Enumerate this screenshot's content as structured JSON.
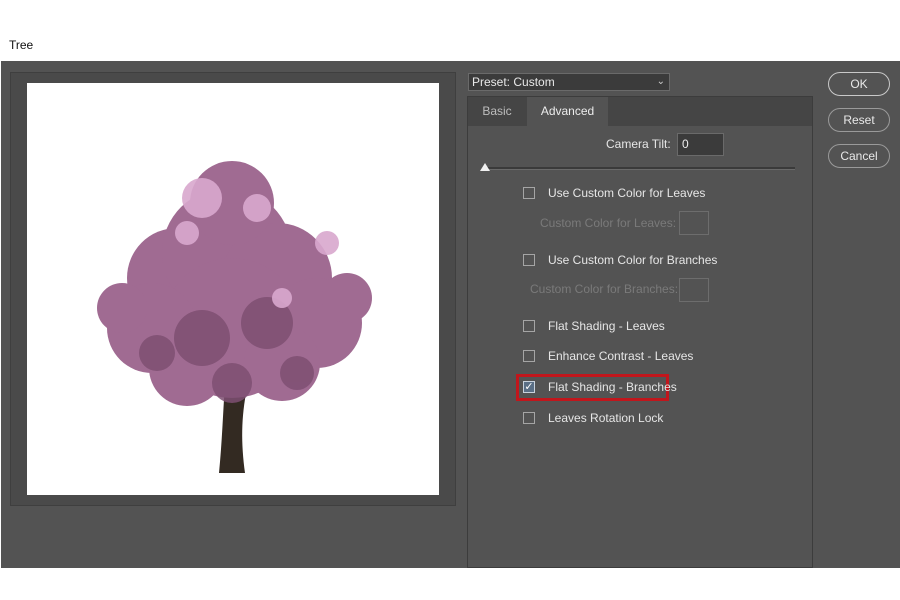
{
  "window": {
    "title": "Tree"
  },
  "preset": {
    "label": "Preset: Custom"
  },
  "tabs": [
    {
      "label": "Basic",
      "active": false
    },
    {
      "label": "Advanced",
      "active": true
    }
  ],
  "camera_tilt": {
    "label": "Camera Tilt:",
    "value": "0"
  },
  "options": {
    "custom_color_leaves": {
      "label": "Use Custom Color for Leaves",
      "checked": false
    },
    "custom_color_leaves_field": {
      "label": "Custom Color for Leaves:"
    },
    "custom_color_branches": {
      "label": "Use Custom Color for Branches",
      "checked": false
    },
    "custom_color_branches_field": {
      "label": "Custom Color for Branches:"
    },
    "flat_shading_leaves": {
      "label": "Flat Shading - Leaves",
      "checked": false
    },
    "enhance_contrast_leaves": {
      "label": "Enhance Contrast - Leaves",
      "checked": false
    },
    "flat_shading_branches": {
      "label": "Flat Shading - Branches",
      "checked": true
    },
    "leaves_rotation_lock": {
      "label": "Leaves Rotation Lock",
      "checked": false
    }
  },
  "buttons": {
    "ok": "OK",
    "reset": "Reset",
    "cancel": "Cancel"
  },
  "colors": {
    "accent_highlight": "#c1161c",
    "panel_bg": "#535353",
    "foliage": "#a06b92",
    "trunk": "#332a22"
  }
}
